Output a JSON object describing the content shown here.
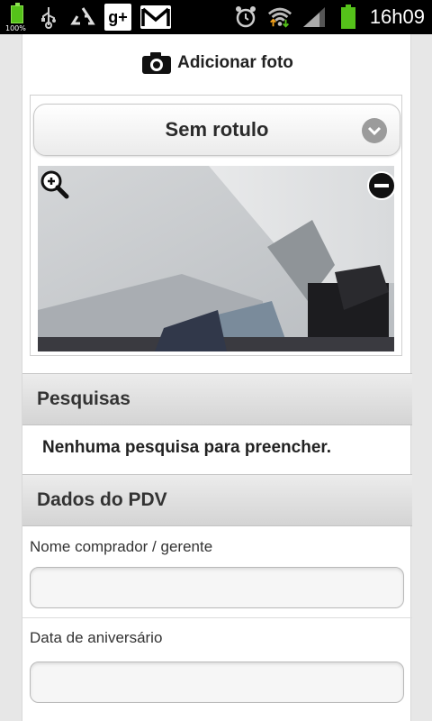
{
  "status_bar": {
    "battery_percent": "100%",
    "time": "16h09"
  },
  "photo_section": {
    "add_photo_label": "Adicionar foto",
    "label_select_value": "Sem rotulo"
  },
  "sections": {
    "pesquisas": {
      "title": "Pesquisas",
      "empty_message": "Nenhuma pesquisa para preencher."
    },
    "dados_pdv": {
      "title": "Dados do PDV",
      "fields": [
        {
          "label": "Nome comprador / gerente",
          "value": ""
        },
        {
          "label": "Data de aniversário",
          "value": ""
        }
      ]
    }
  },
  "icons": {
    "camera": "camera-icon",
    "zoom": "zoom-in-icon",
    "remove": "remove-icon",
    "dropdown": "chevron-down-icon"
  },
  "colors": {
    "battery_green": "#55c21a",
    "section_bg": "#dcdcdc",
    "statusbar_bg": "#000000"
  }
}
